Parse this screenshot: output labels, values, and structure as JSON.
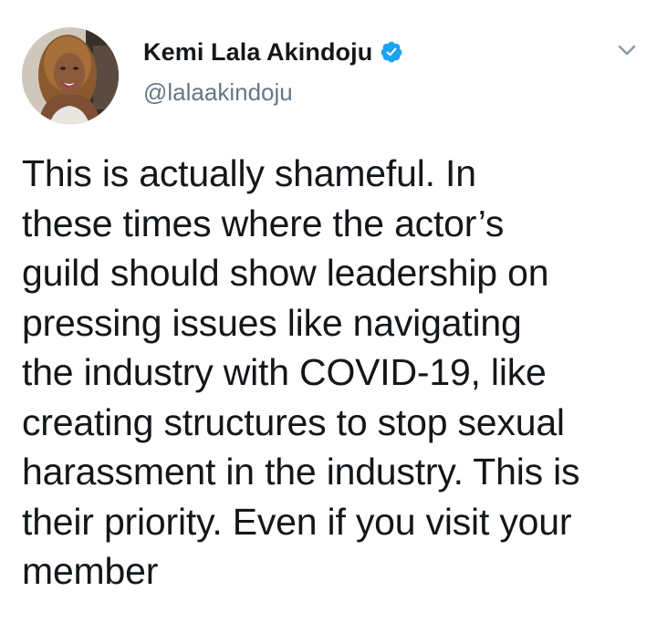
{
  "author": {
    "display_name": "Kemi Lala Akindoju",
    "handle": "@lalaakindoju",
    "verified": true,
    "avatar_icon": "profile-photo",
    "verified_icon": "verified-badge-icon",
    "menu_icon": "chevron-down-icon"
  },
  "tweet": {
    "text": "This is actually shameful. In\nthese times where the actor’s\nguild should show leadership on\npressing issues like navigating\nthe industry with COVID-19, like\ncreating structures to stop sexual\nharassment in the industry. This is\ntheir priority. Even if you visit your\nmember"
  },
  "colors": {
    "text": "#14171a",
    "secondary": "#657786",
    "verified": "#1da1f2",
    "background": "#ffffff"
  }
}
